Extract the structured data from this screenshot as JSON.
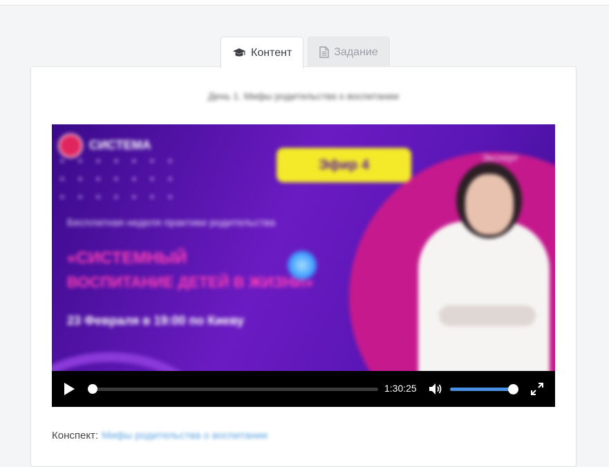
{
  "tabs": [
    {
      "label": "Контент",
      "icon": "graduation-cap-icon",
      "active": true
    },
    {
      "label": "Задание",
      "icon": "document-icon",
      "active": false
    }
  ],
  "lesson": {
    "title": "День 1. Мифы родительства о воспитании"
  },
  "video": {
    "poster": {
      "badge": "Эфир 4",
      "brand": "СИСТЕМА",
      "subtitle": "Бесплатная неделя практики родительства",
      "headline_1": "«СИСТЕМНЫЙ",
      "headline_2": "ВОСПИТАНИЕ ДЕТЕЙ В ЖИЗНИ»",
      "date_line": "23 Февраля в 19:00 по Киеву",
      "corner": "Эксперт"
    },
    "duration": "1:30:25",
    "progress": 0.0,
    "volume": 1.0,
    "accent_color": "#4a90e2"
  },
  "summary": {
    "label": "Конспект:",
    "link_text": "Мифы родительства о воспитании"
  }
}
